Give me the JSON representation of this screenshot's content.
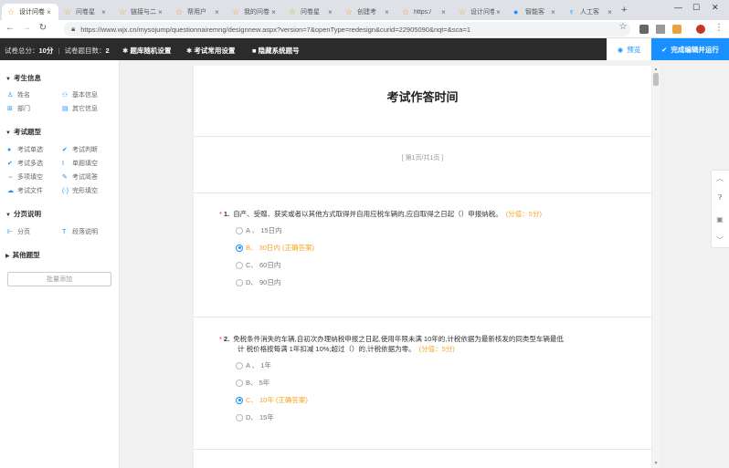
{
  "browser": {
    "tabs": [
      {
        "label": "设计问卷",
        "active": true
      },
      {
        "label": "问卷星",
        "active": false
      },
      {
        "label": "链接与二",
        "active": false
      },
      {
        "label": "帮用户",
        "active": false
      },
      {
        "label": "我的问卷",
        "active": false
      },
      {
        "label": "问卷星",
        "active": false
      },
      {
        "label": "创建考",
        "active": false
      },
      {
        "label": "https:/",
        "active": false
      },
      {
        "label": "设计问卷",
        "active": false
      },
      {
        "label": "智能客",
        "active": false
      },
      {
        "label": "人工客",
        "active": false
      }
    ],
    "url": "https://www.wjx.cn/mysojump/questionnairemng/designnew.aspx?version=7&openType=redesign&curid=22905090&nqt=&sca=1"
  },
  "header": {
    "total_score_label": "试卷总分：",
    "total_score": "10分",
    "count_label": "试卷题目数：",
    "count": "2",
    "menu": [
      "题库随机设置",
      "考试常用设置",
      "隐藏系统题号"
    ],
    "preview": "预览",
    "finish": "完成编辑并运行"
  },
  "sidebar": {
    "sections": [
      {
        "title": "考生信息",
        "items": [
          "姓名",
          "基本信息",
          "部门",
          "其它信息"
        ]
      },
      {
        "title": "考试题型",
        "items": [
          "考试单选",
          "考试判断",
          "考试多选",
          "单题填空",
          "多项填空",
          "考试简答",
          "考试文件",
          "完形填空"
        ]
      },
      {
        "title": "分页说明",
        "items": [
          "分页",
          "段落说明"
        ]
      },
      {
        "title": "其他题型",
        "items": []
      }
    ],
    "batch_add": "批量添加"
  },
  "paper": {
    "title": "考试作答时间",
    "page": "[ 第1页/共1页 ]",
    "questions": [
      {
        "number": "1.",
        "text": "自产、受赠、获奖或者以其他方式取得并自用应税车辆的,应自取得之日起（）申报纳税。",
        "score": "(分值：5分)",
        "options": [
          {
            "label": "A 、 15日内",
            "correct": false
          },
          {
            "label": "B、 30日内 (正确答案)",
            "correct": true
          },
          {
            "label": "C、 60日内",
            "correct": false
          },
          {
            "label": "D、 90日内",
            "correct": false
          }
        ]
      },
      {
        "number": "2.",
        "text_line1": "免税条件消失的车辆,自初次办理纳税申报之日起,使用年限未满 10年的,计税依据为最新核发的同类型车辆最低",
        "text_line2": "计 税价格按每满 1年扣减 10%;超过（）的,计税依据为零。",
        "score": "(分值：5分)",
        "options": [
          {
            "label": "A 、 1年",
            "correct": false
          },
          {
            "label": "B、 5年",
            "correct": false
          },
          {
            "label": "C、 10年 (正确答案)",
            "correct": true
          },
          {
            "label": "D、 15年",
            "correct": false
          }
        ]
      }
    ]
  },
  "icons": {
    "star": "star-icon",
    "close": "close-icon",
    "back": "back-arrow-icon",
    "lock": "lock-icon",
    "eye": "eye-icon",
    "check": "check-icon",
    "gear": "gear-icon",
    "up": "arrow-up-icon",
    "help": "question-icon",
    "chat": "chat-icon",
    "down": "arrow-down-icon"
  }
}
